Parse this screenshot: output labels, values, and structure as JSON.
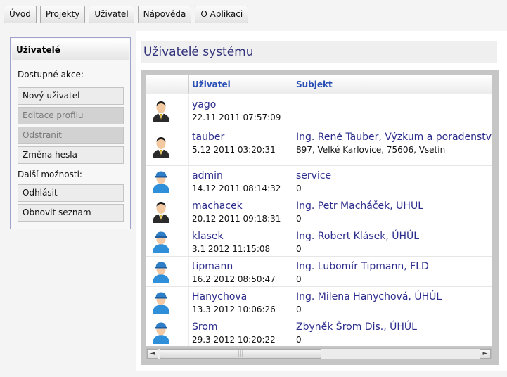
{
  "nav": {
    "items": [
      {
        "label": "Úvod"
      },
      {
        "label": "Projekty"
      },
      {
        "label": "Uživatel"
      },
      {
        "label": "Nápověda"
      },
      {
        "label": "O Aplikaci"
      }
    ]
  },
  "sidebar": {
    "title": "Uživatelé",
    "available_actions_label": "Dostupné akce:",
    "actions": [
      {
        "label": "Nový uživatel",
        "enabled": true
      },
      {
        "label": "Editace profilu",
        "enabled": false
      },
      {
        "label": "Odstranit",
        "enabled": false
      },
      {
        "label": "Změna hesla",
        "enabled": true
      }
    ],
    "more_options_label": "Další možnosti:",
    "more": [
      {
        "label": "Odhlásit"
      },
      {
        "label": "Obnovit seznam"
      }
    ]
  },
  "main": {
    "title": "Uživatelé systému",
    "columns": {
      "user": "Uživatel",
      "subject": "Subjekt"
    },
    "rows": [
      {
        "user": "yago",
        "date": "22.11 2011 07:57:09",
        "subject": "",
        "address": "",
        "icon": "user-suit-icon"
      },
      {
        "user": "tauber",
        "date": "5.12 2011 03:20:31",
        "subject": "Ing. René Tauber, Výzkum a poradenství v",
        "address": "897, Velké Karlovice, 75606, Vsetín",
        "icon": "user-suit-icon"
      },
      {
        "user": "admin",
        "date": "14.12 2011 08:14:32",
        "subject": "service",
        "address": "0",
        "icon": "user-worker-icon"
      },
      {
        "user": "machacek",
        "date": "20.12 2011 09:18:31",
        "subject": "Ing. Petr Macháček, UHUL",
        "address": "0",
        "icon": "user-suit-icon"
      },
      {
        "user": "klasek",
        "date": "3.1 2012 11:15:08",
        "subject": "Ing. Robert Klásek, ÚHÚL",
        "address": "0",
        "icon": "user-worker-icon"
      },
      {
        "user": "tipmann",
        "date": "16.2 2012 08:50:47",
        "subject": "Ing. Lubomír Tipmann, FLD",
        "address": "0",
        "icon": "user-worker-icon"
      },
      {
        "user": "Hanychova",
        "date": "13.3 2012 10:06:26",
        "subject": "Ing. Milena Hanychová, ÚHÚL",
        "address": "0",
        "icon": "user-worker-icon"
      },
      {
        "user": "Srom",
        "date": "29.3 2012 10:20:22",
        "subject": "Zbyněk Šrom Dis., ÚHÚL",
        "address": "0",
        "icon": "user-worker-icon"
      }
    ]
  },
  "scrollbar": {
    "left_glyph": "◄",
    "right_glyph": "►",
    "thumb_glyph": "|||"
  },
  "colors": {
    "link": "#2c2c8c",
    "header_link": "#2a4fb5",
    "title": "#31317a"
  }
}
